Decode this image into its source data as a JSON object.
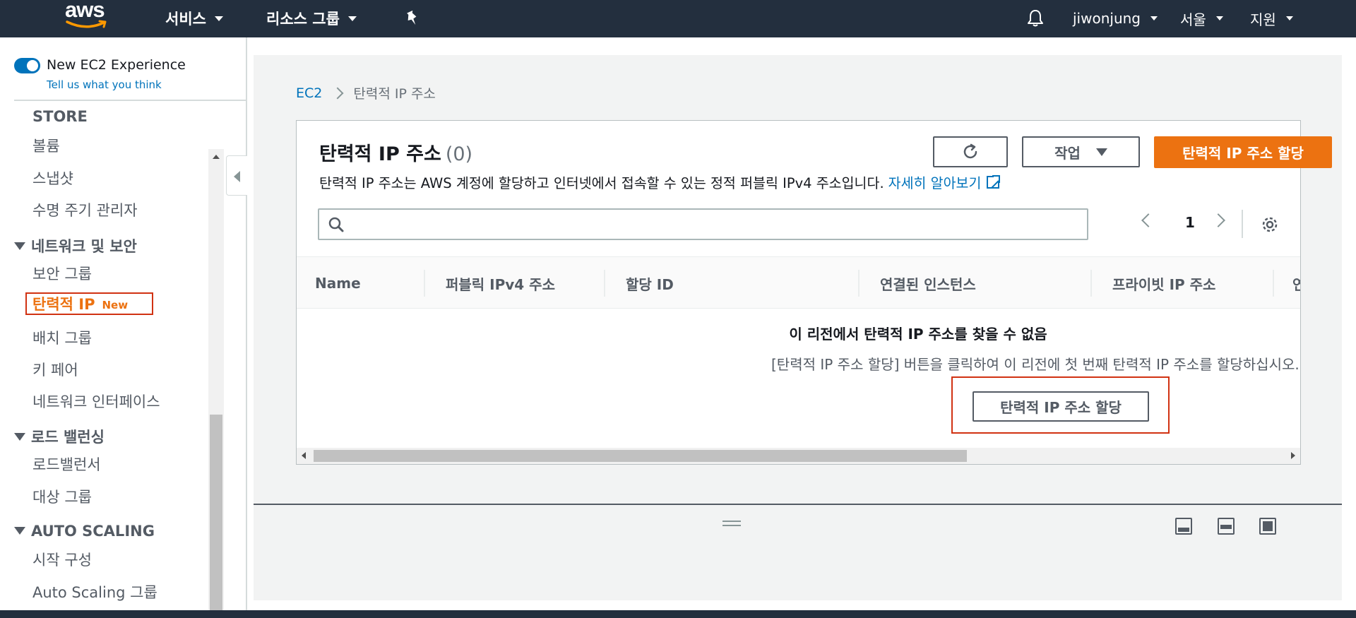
{
  "nav": {
    "logo": "aws",
    "services": "서비스",
    "resource_groups": "리소스 그룹",
    "user": "jiwonjung",
    "region": "서울",
    "support": "지원"
  },
  "sidebar": {
    "new_experience": "New EC2 Experience",
    "tell_us": "Tell us what you think",
    "store_header": "STORE",
    "store_items": [
      "볼륨",
      "스냅샷",
      "수명 주기 관리자"
    ],
    "network_header": "네트워크 및 보안",
    "network_items": [
      "보안 그룹",
      "탄력적 IP",
      "배치 그룹",
      "키 페어",
      "네트워크 인터페이스"
    ],
    "active_new_tag": "New",
    "lb_header": "로드 밸런싱",
    "lb_items": [
      "로드밸런서",
      "대상 그룹"
    ],
    "as_header": "AUTO SCALING",
    "as_items": [
      "시작 구성",
      "Auto Scaling 그룹"
    ]
  },
  "breadcrumb": {
    "root": "EC2",
    "current": "탄력적 IP 주소"
  },
  "panel": {
    "title": "탄력적 IP 주소",
    "count": "(0)",
    "description": "탄력적 IP 주소는 AWS 계정에 할당하고 인터넷에서 접속할 수 있는 정적 퍼블릭 IPv4 주소입니다.",
    "learn_more": "자세히 알아보기",
    "action_label": "작업",
    "allocate_label": "탄력적 IP 주소 할당",
    "page_number": "1",
    "columns": [
      "Name",
      "퍼블릭 IPv4 주소",
      "할당 ID",
      "연결된 인스턴스",
      "프라이빗 IP 주소",
      "연"
    ],
    "empty_title": "이 리전에서 탄력적 IP 주소를 찾을 수 없음",
    "empty_desc": "[탄력적 IP 주소 할당] 버튼을 클릭하여 이 리전에 첫 번째 탄력적 IP 주소를 할당하십시오.",
    "empty_button": "탄력적 IP 주소 할당"
  },
  "colors": {
    "nav_bg": "#232f3e",
    "primary": "#ec7211",
    "link": "#0073bb",
    "highlight": "#d13212"
  }
}
